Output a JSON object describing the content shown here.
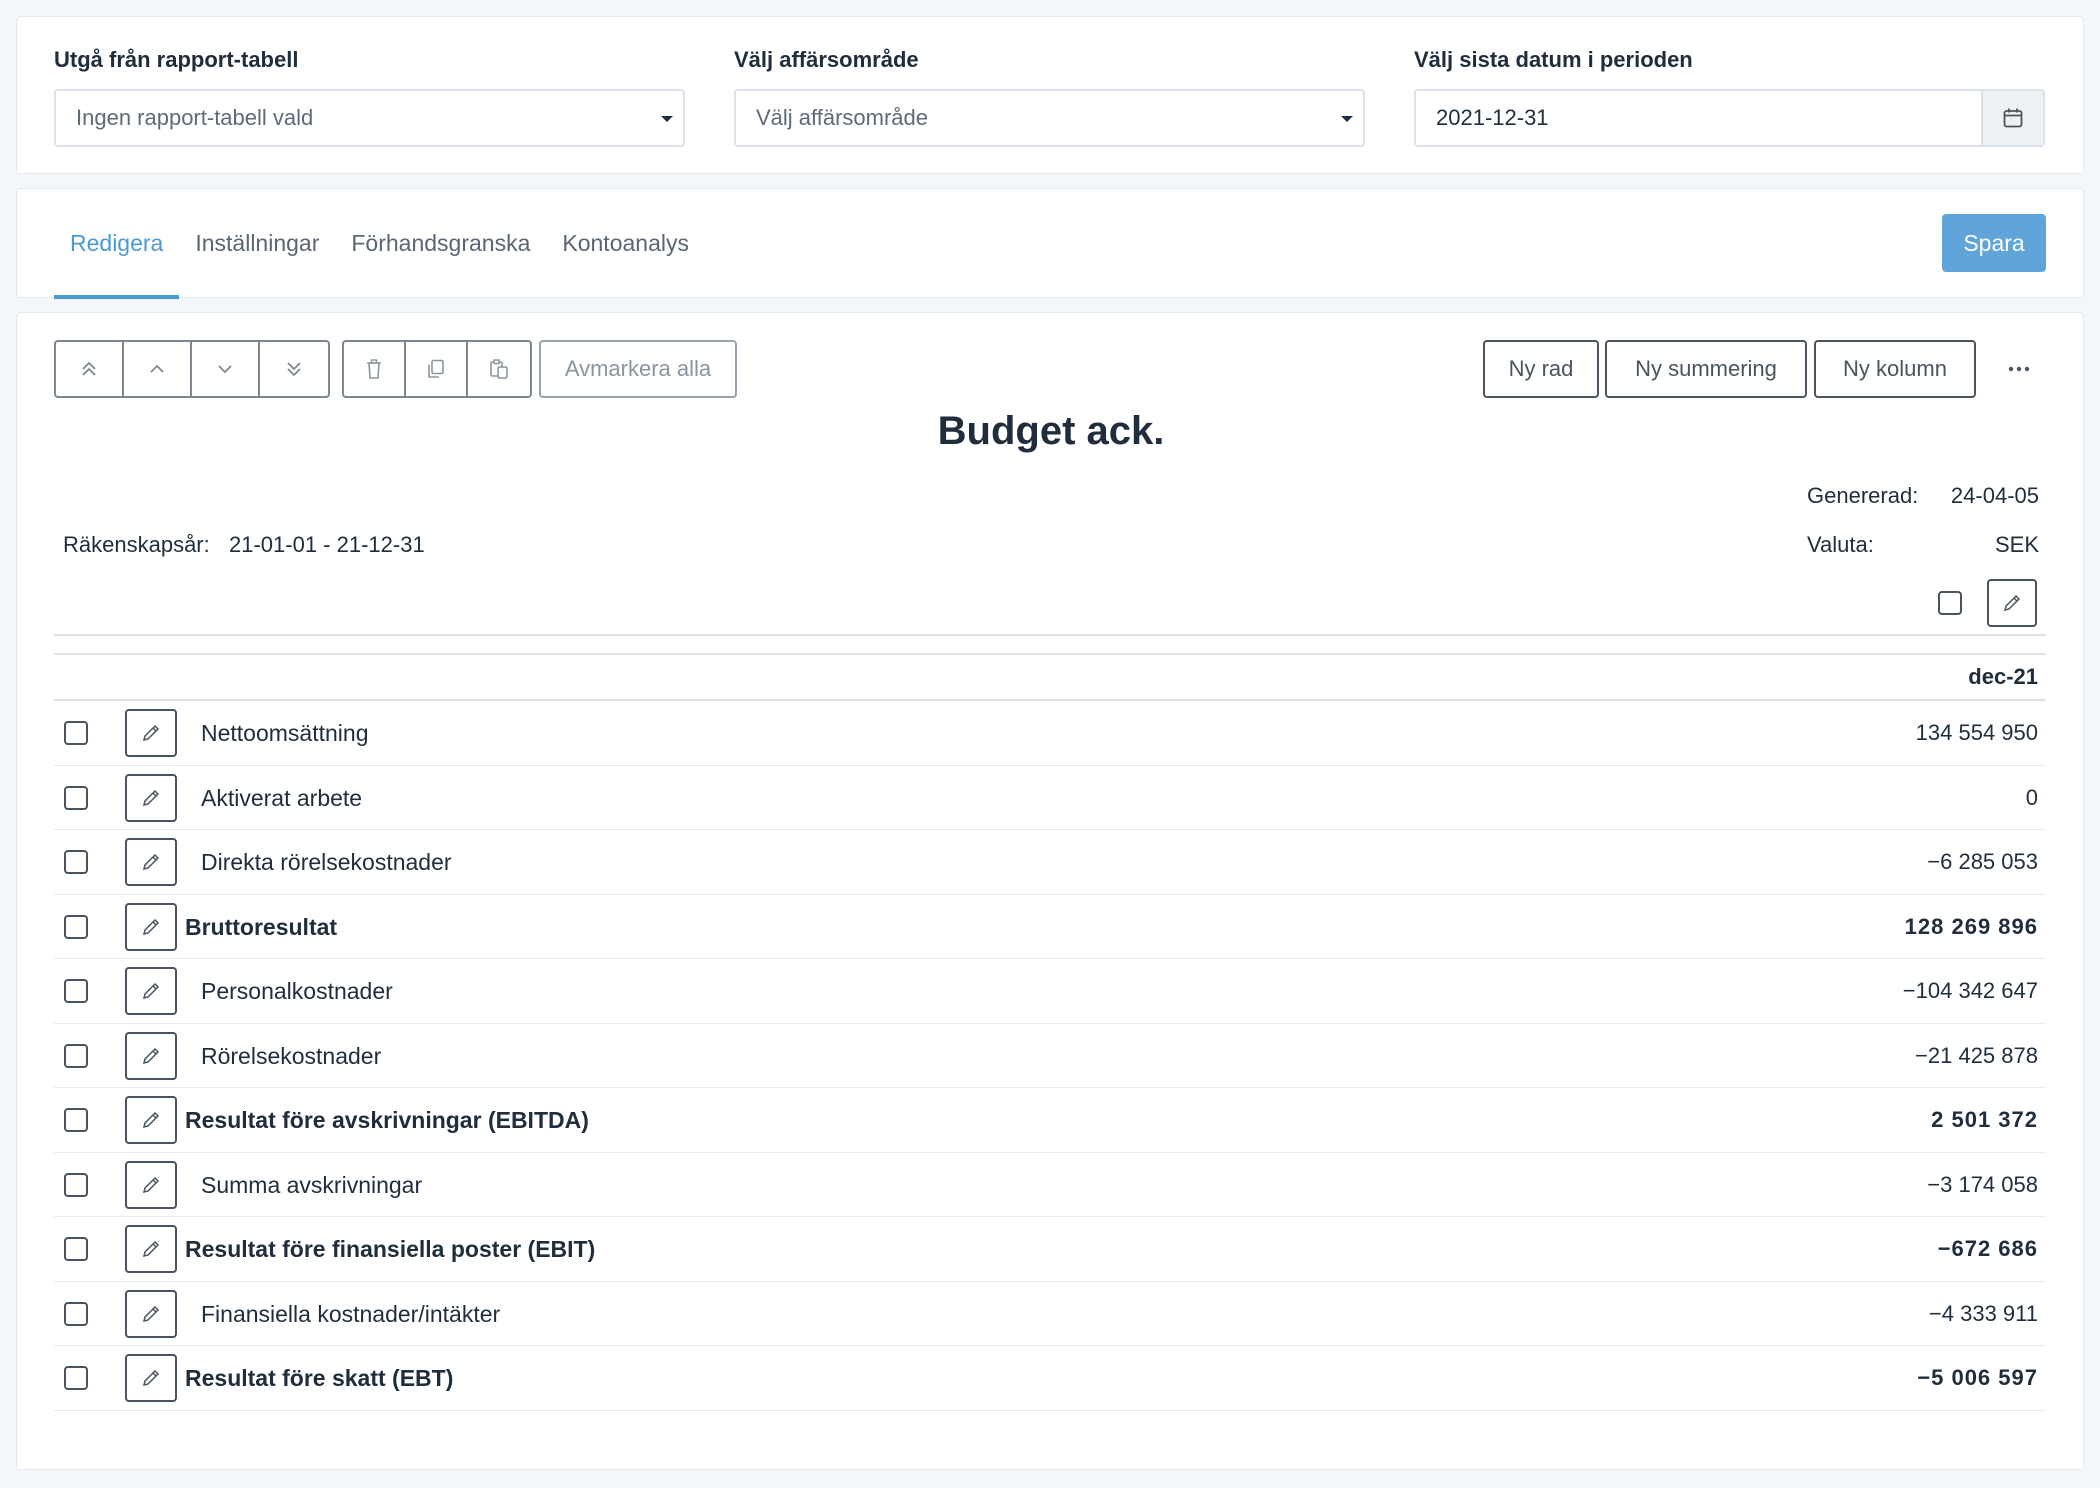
{
  "filters": {
    "report_table": {
      "label": "Utgå från rapport-tabell",
      "value": "Ingen rapport-tabell vald"
    },
    "business_area": {
      "label": "Välj affärsområde",
      "value": "Välj affärsområde"
    },
    "last_date": {
      "label": "Välj sista datum i perioden",
      "value": "2021-12-31"
    }
  },
  "tabs": [
    {
      "label": "Redigera",
      "active": true
    },
    {
      "label": "Inställningar",
      "active": false
    },
    {
      "label": "Förhandsgranska",
      "active": false
    },
    {
      "label": "Kontoanalys",
      "active": false
    }
  ],
  "save_label": "Spara",
  "toolbar": {
    "deselect_all": "Avmarkera alla",
    "new_row": "Ny rad",
    "new_sum": "Ny summering",
    "new_column": "Ny kolumn",
    "icons": [
      "move-to-top-icon",
      "move-up-icon",
      "move-down-icon",
      "move-to-bottom-icon",
      "trash-icon",
      "copy-icon",
      "paste-icon",
      "more-icon"
    ]
  },
  "report": {
    "title": "Budget ack.",
    "generated_label": "Genererad:",
    "generated_value": "24-04-05",
    "fiscal_label": "Räkenskapsår:",
    "fiscal_value": "21-01-01 - 21-12-31",
    "currency_label": "Valuta:",
    "currency_value": "SEK",
    "column_header": "dec-21"
  },
  "rows": [
    {
      "label": "Nettoomsättning",
      "value": "134 554 950",
      "bold": false
    },
    {
      "label": "Aktiverat arbete",
      "value": "0",
      "bold": false
    },
    {
      "label": "Direkta rörelsekostnader",
      "value": "−6 285 053",
      "bold": false
    },
    {
      "label": "Bruttoresultat",
      "value": "128 269 896",
      "bold": true
    },
    {
      "label": "Personalkostnader",
      "value": "−104 342 647",
      "bold": false
    },
    {
      "label": "Rörelsekostnader",
      "value": "−21 425 878",
      "bold": false
    },
    {
      "label": "Resultat före avskrivningar (EBITDA)",
      "value": "2 501 372",
      "bold": true
    },
    {
      "label": "Summa avskrivningar",
      "value": "−3 174 058",
      "bold": false
    },
    {
      "label": "Resultat före finansiella poster (EBIT)",
      "value": "−672 686",
      "bold": true
    },
    {
      "label": "Finansiella kostnader/intäkter",
      "value": "−4 333 911",
      "bold": false
    },
    {
      "label": "Resultat före skatt (EBT)",
      "value": "−5 006 597",
      "bold": true
    }
  ],
  "colors": {
    "accent": "#4a9ad4",
    "save_button": "#5fa5d9"
  }
}
